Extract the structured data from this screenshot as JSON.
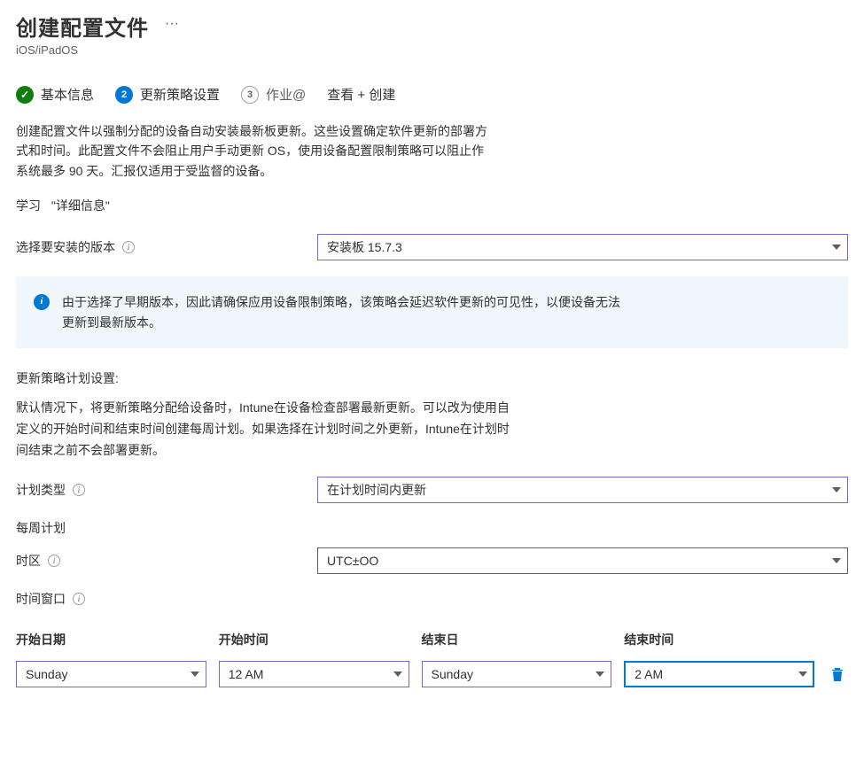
{
  "header": {
    "title": "创建配置文件",
    "subtitle": "iOS/iPadOS",
    "more": "···"
  },
  "steps": {
    "s1": "基本信息",
    "s2": "更新策略设置",
    "s3_num": "3",
    "s3": "作业@",
    "s4": "查看 + 创建"
  },
  "intro": {
    "desc": "创建配置文件以强制分配的设备自动安装最新板更新。这些设置确定软件更新的部署方式和时间。此配置文件不会阻止用户手动更新 OS，使用设备配置限制策略可以阻止作系统最多 90 天。汇报仅适用于受监督的设备。",
    "learn": "学习",
    "learn_link": "\"详细信息\""
  },
  "version": {
    "label": "选择要安装的版本",
    "value": "安装板 15.7.3"
  },
  "banner": "由于选择了早期版本，因此请确保应用设备限制策略，该策略会延迟软件更新的可见性，以便设备无法更新到最新版本。",
  "schedule": {
    "section_title": "更新策略计划设置:",
    "desc": "默认情况下，将更新策略分配给设备时，Intune在设备检查部署最新更新。可以改为使用自定义的开始时间和结束时间创建每周计划。如果选择在计划时间之外更新，Intune在计划时间结束之前不会部署更新。",
    "type_label": "计划类型",
    "type_value": "在计划时间内更新",
    "weekly_label": "每周计划",
    "tz_label": "时区",
    "tz_value": "UTC±OO",
    "window_label": "时间窗口"
  },
  "time_window": {
    "col_start_day": "开始日期",
    "col_start_time": "开始时间",
    "col_end_day": "结束日",
    "col_end_time": "结束时间",
    "row": {
      "start_day": "Sunday",
      "start_time": "12 AM",
      "end_day": "Sunday",
      "end_time": "2 AM"
    }
  }
}
